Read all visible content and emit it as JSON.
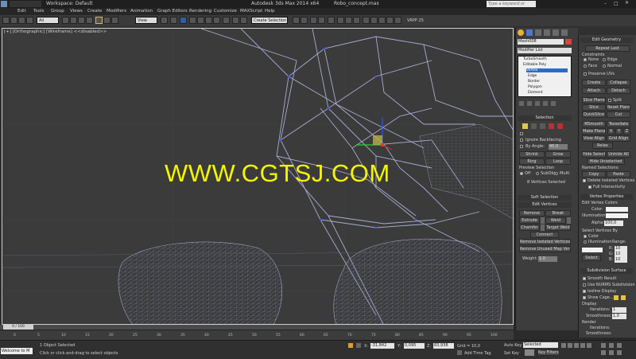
{
  "titlebar": {
    "workspace": "Workspace: Default",
    "app_title": "Autodesk 3ds Max 2014 x64",
    "file_name": "Robo_concept.max",
    "search_placeholder": "Type a keyword or phrase"
  },
  "menus": [
    "Edit",
    "Tools",
    "Group",
    "Views",
    "Create",
    "Modifiers",
    "Animation",
    "Graph Editors",
    "Rendering",
    "Customize",
    "MAXScript",
    "Help"
  ],
  "toolbar": {
    "selection_filter": "All",
    "ref_coord": "View",
    "named_selection": "Create Selection Se",
    "vray_label": "VRPP 25"
  },
  "viewport": {
    "label": "[+] [Orthographic] [Wireframe] <<disabled>>",
    "watermark": "WWW.CGTSJ.COM"
  },
  "command_panel": {
    "object_name": "Mesh008",
    "modifier_list": "Modifier List",
    "stack": [
      "TurboSmooth",
      "Editable Poly",
      "Vertex",
      "Edge",
      "Border",
      "Polygon",
      "Element"
    ],
    "selection_header": "Selection",
    "ignore_backfacing": "Ignore Backfacing",
    "by_angle": "By Angle:",
    "by_angle_value": "45.0",
    "shrink": "Shrink",
    "grow": "Grow",
    "ring": "Ring",
    "loop": "Loop",
    "preview_selection": "Preview Selection",
    "preview_off": "Off",
    "preview_subobj": "SubObj",
    "preview_multi": "Multi",
    "selected_count": "8 Vertices Selected",
    "soft_selection": "Soft Selection",
    "edit_vertices": "Edit Vertices",
    "remove": "Remove",
    "break": "Break",
    "extrude": "Extrude",
    "weld": "Weld",
    "chamfer": "Chamfer",
    "target_weld": "Target Weld",
    "connect": "Connect",
    "remove_isolated": "Remove Isolated Vertices",
    "remove_unused": "Remove Unused Map Verts",
    "weight_label": "Weight:",
    "weight_value": "1,0"
  },
  "edit_geometry": {
    "header": "Edit Geometry",
    "repeat_last": "Repeat Last",
    "constraints": "Constraints",
    "none": "None",
    "edge": "Edge",
    "face": "Face",
    "normal": "Normal",
    "preserve_uvs": "Preserve UVs",
    "create": "Create",
    "collapse": "Collapse",
    "attach": "Attach",
    "detach": "Detach",
    "slice_plane": "Slice Plane",
    "split": "Split",
    "slice": "Slice",
    "reset_plane": "Reset Plane",
    "quickslice": "QuickSlice",
    "cut": "Cut",
    "msmooth": "MSmooth",
    "tessellate": "Tessellate",
    "make_planar": "Make Planar",
    "x": "X",
    "y": "Y",
    "z": "Z",
    "view_align": "View Align",
    "grid_align": "Grid Align",
    "relax": "Relax",
    "hide_selected": "Hide Selected",
    "unhide_all": "Unhide All",
    "hide_unselected": "Hide Unselected",
    "named_selections": "Named Selections:",
    "copy": "Copy",
    "paste": "Paste",
    "delete_isolated": "Delete Isolated Vertices",
    "full_interactivity": "Full Interactivity"
  },
  "vertex_properties": {
    "header": "Vertex Properties",
    "edit_vertex_colors": "Edit Vertex Colors",
    "color": "Color:",
    "illumination": "Illumination:",
    "alpha": "Alpha:",
    "alpha_value": "100,0",
    "select_vertices_by": "Select Vertices By",
    "color_opt": "Color",
    "illumination_opt": "Illumination",
    "range": "Range:",
    "r": "R:",
    "g": "G:",
    "b": "B:",
    "range_value": "10",
    "select": "Select"
  },
  "subdivision": {
    "header": "Subdivision Surface",
    "smooth_result": "Smooth Result",
    "use_nurms": "Use NURMS Subdivision",
    "isoline_display": "Isoline Display",
    "show_cage": "Show Cage......",
    "display": "Display",
    "iterations_label": "Iterations:",
    "iterations_value": "1",
    "smoothness_label": "Smoothness:",
    "smoothness_value": "1,0",
    "render": "Render",
    "render_iterations": "Iterations:",
    "render_smoothness": "Smoothness:"
  },
  "timeline": {
    "frame": "0 / 100",
    "ticks": [
      "0",
      "5",
      "10",
      "15",
      "20",
      "25",
      "30",
      "35",
      "40",
      "45",
      "50",
      "55",
      "60",
      "65",
      "70",
      "75",
      "80",
      "85",
      "90",
      "95",
      "100"
    ]
  },
  "status": {
    "welcome": "Welcome to M",
    "objects_selected": "1 Object Selected",
    "hint": "Click or click-and-drag to select objects",
    "x_label": "X:",
    "x_value": "-31,842",
    "y_label": "Y:",
    "y_value": "0,095",
    "z_label": "Z:",
    "z_value": "83,938",
    "grid": "Grid = 10,0",
    "auto_key": "Auto Key",
    "set_key": "Set Key",
    "selected": "Selected",
    "key_filters": "Key Filters...",
    "add_time_tag": "Add Time Tag"
  },
  "colors": {
    "watermark": "#f5f500",
    "wire": "#9aa0c8",
    "selection_blue": "#2a6bd0"
  }
}
